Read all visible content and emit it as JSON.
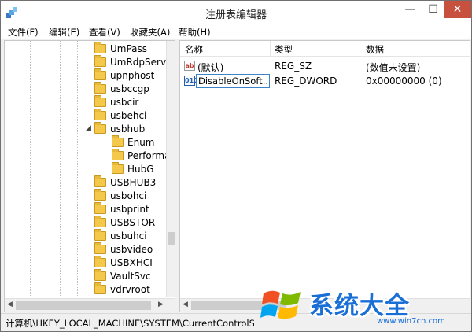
{
  "window": {
    "title": "注册表编辑器"
  },
  "controls": {
    "minimize": "—",
    "maximize": "☐",
    "close": "✕"
  },
  "menu": [
    "文件(F)",
    "编辑(E)",
    "查看(V)",
    "收藏夹(A)",
    "帮助(H)"
  ],
  "tree": {
    "nodes": [
      {
        "label": "UmPass",
        "level": 1,
        "expander": ""
      },
      {
        "label": "UmRdpServ",
        "level": 1,
        "expander": ""
      },
      {
        "label": "upnphost",
        "level": 1,
        "expander": ""
      },
      {
        "label": "usbccgp",
        "level": 1,
        "expander": ""
      },
      {
        "label": "usbcir",
        "level": 1,
        "expander": ""
      },
      {
        "label": "usbehci",
        "level": 1,
        "expander": ""
      },
      {
        "label": "usbhub",
        "level": 1,
        "expander": "expanded"
      },
      {
        "label": "Enum",
        "level": 2,
        "expander": ""
      },
      {
        "label": "Performa",
        "level": 2,
        "expander": ""
      },
      {
        "label": "HubG",
        "level": 2,
        "expander": ""
      },
      {
        "label": "USBHUB3",
        "level": 1,
        "expander": ""
      },
      {
        "label": "usbohci",
        "level": 1,
        "expander": ""
      },
      {
        "label": "usbprint",
        "level": 1,
        "expander": ""
      },
      {
        "label": "USBSTOR",
        "level": 1,
        "expander": ""
      },
      {
        "label": "usbuhci",
        "level": 1,
        "expander": ""
      },
      {
        "label": "usbvideo",
        "level": 1,
        "expander": ""
      },
      {
        "label": "USBXHCI",
        "level": 1,
        "expander": ""
      },
      {
        "label": "VaultSvc",
        "level": 1,
        "expander": ""
      },
      {
        "label": "vdrvroot",
        "level": 1,
        "expander": ""
      }
    ]
  },
  "list": {
    "columns": [
      "名称",
      "类型",
      "数据"
    ],
    "rows": [
      {
        "icon": "ab",
        "name": "(默认)",
        "type": "REG_SZ",
        "data": "(数值未设置)"
      },
      {
        "icon": "010",
        "name": "DisableOnSoft...",
        "type": "REG_DWORD",
        "data": "0x00000000 (0)"
      }
    ]
  },
  "status": {
    "path": "计算机\\HKEY_LOCAL_MACHINE\\SYSTEM\\CurrentControlSet"
  },
  "watermark": {
    "name": "系统大全",
    "url": "www.win7cn.com"
  },
  "colors": {
    "watermark_blue": "#1a6fd6",
    "close_red": "#c7503e",
    "folder_yellow": "#f3c84b"
  }
}
